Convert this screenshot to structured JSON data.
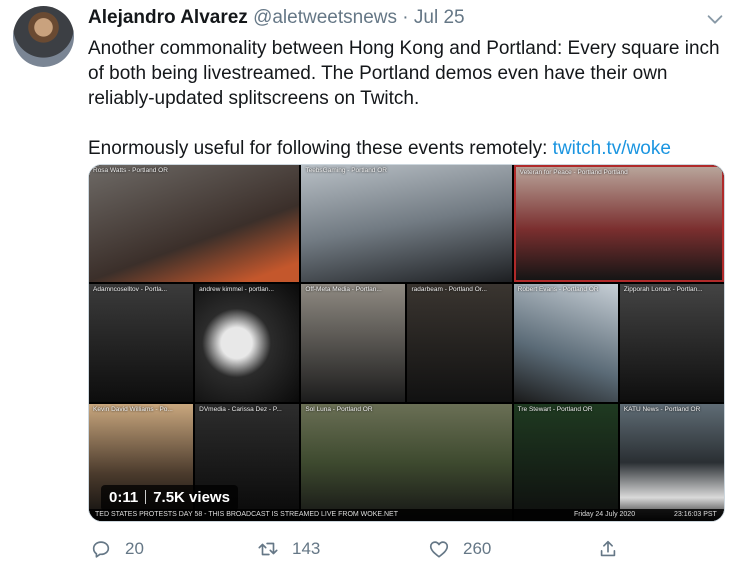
{
  "author": {
    "name": "Alejandro Alvarez",
    "handle": "@aletweetsnews",
    "separator": "·",
    "date": "Jul 25"
  },
  "tweet": {
    "paragraph1": "Another commonality between Hong Kong and Portland: Every square inch of both being livestreamed. The Portland demos even have their own reliably-updated splitscreens on Twitch.",
    "paragraph2_text": "Enormously useful for following these events remotely: ",
    "link": "twitch.tv/woke"
  },
  "media": {
    "time": "0:11",
    "views": "7.5K views",
    "streams": [
      {
        "label": "Rosa Watts - Portland OR"
      },
      {
        "label": "TeebsGaming - Portland OR"
      },
      {
        "label": "Veteran for Peace - Portland Portland"
      },
      {
        "label": "Adamncoselltov - Portla..."
      },
      {
        "label": "andrew kimmel - portlan..."
      },
      {
        "label": "Off-Meta Media - Portlan..."
      },
      {
        "label": "radarbeam - Portland Or..."
      },
      {
        "label": "Robert Evans - Portland OR"
      },
      {
        "label": "Zipporah Lomax - Portlan..."
      },
      {
        "label": "Kevin David Williams - Po..."
      },
      {
        "label": "DVmedia - Carissa Dez - P..."
      },
      {
        "label": "Sol Luna - Portland OR"
      },
      {
        "label": "Tre Stewart - Portland OR"
      },
      {
        "label": "KATU News - Portland OR"
      }
    ],
    "ticker_left": "TED STATES PROTESTS DAY 58 - THIS BROADCAST IS STREAMED LIVE FROM WOKE.NET",
    "ticker_date": "Friday 24 July 2020",
    "ticker_time": "23:16:03 PST"
  },
  "actions": {
    "replies": "20",
    "retweets": "143",
    "likes": "260"
  },
  "icons": [
    "chevron-down-icon",
    "reply-icon",
    "retweet-icon",
    "like-icon",
    "share-icon"
  ],
  "colors": {
    "link": "#1b95e0",
    "muted": "#657786",
    "text": "#14171a"
  }
}
